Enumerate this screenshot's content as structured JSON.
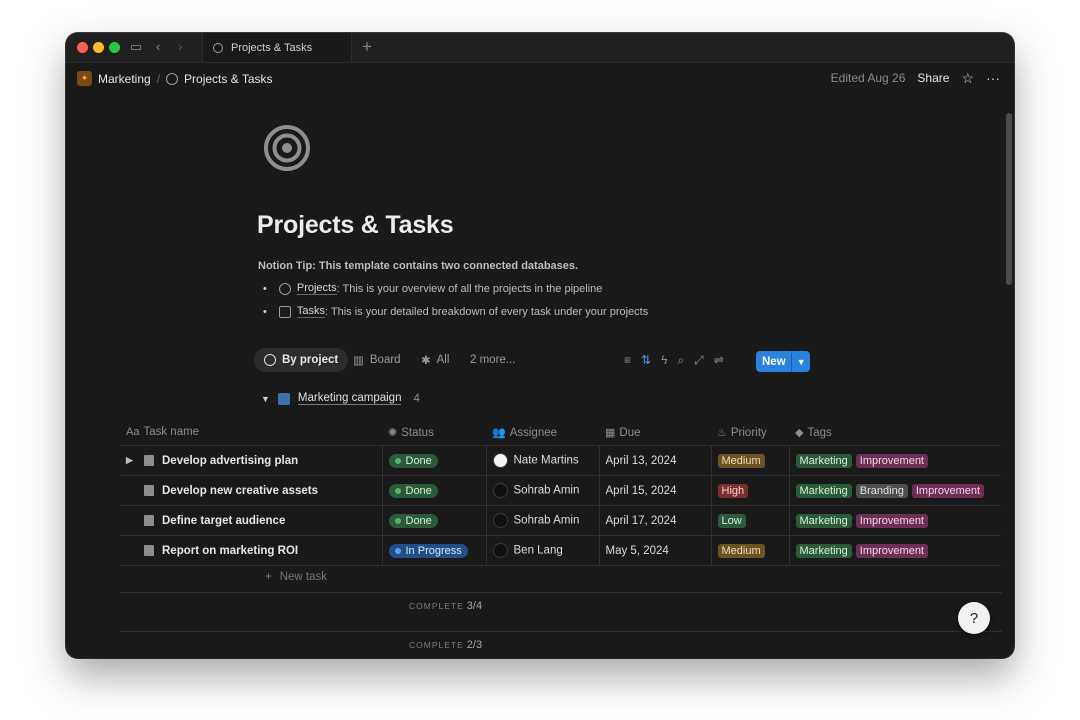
{
  "tab": {
    "title": "Projects & Tasks"
  },
  "breadcrumb": {
    "workspace": "Marketing",
    "separator": "/",
    "page": "Projects & Tasks"
  },
  "topbar": {
    "edited": "Edited Aug 26",
    "share": "Share",
    "favorite_icon": "star-icon",
    "more_icon": "more-icon"
  },
  "page": {
    "title": "Projects & Tasks",
    "tip": "Notion Tip: This template contains two connected databases.",
    "bullets": [
      {
        "link": "Projects",
        "text": ": This is your overview of all the projects in the pipeline"
      },
      {
        "link": "Tasks",
        "text": ": This is your detailed breakdown of every task under your projects"
      }
    ]
  },
  "views": {
    "by_project": "By project",
    "board": "Board",
    "all": "All",
    "more": "2 more...",
    "new": "New"
  },
  "group": {
    "name": "Marketing campaign",
    "count": "4"
  },
  "table": {
    "headers": {
      "task": "Task name",
      "status": "Status",
      "assignee": "Assignee",
      "due": "Due",
      "priority": "Priority",
      "tags": "Tags"
    },
    "rows": [
      {
        "task": "Develop advertising plan",
        "status": "Done",
        "assignee": "Nate Martins",
        "due": "April 13, 2024",
        "priority": "Medium",
        "tags": [
          "Marketing",
          "Improvement"
        ]
      },
      {
        "task": "Develop new creative assets",
        "status": "Done",
        "assignee": "Sohrab Amin",
        "due": "April 15, 2024",
        "priority": "High",
        "tags": [
          "Marketing",
          "Branding",
          "Improvement"
        ]
      },
      {
        "task": "Define target audience",
        "status": "Done",
        "assignee": "Sohrab Amin",
        "due": "April 17, 2024",
        "priority": "Low",
        "tags": [
          "Marketing",
          "Improvement"
        ]
      },
      {
        "task": "Report on marketing ROI",
        "status": "In Progress",
        "assignee": "Ben Lang",
        "due": "May 5, 2024",
        "priority": "Medium",
        "tags": [
          "Marketing",
          "Improvement"
        ]
      }
    ],
    "new_task": "New task"
  },
  "summary": [
    {
      "label": "COMPLETE",
      "value": "3/4"
    },
    {
      "label": "COMPLETE",
      "value": "2/3"
    }
  ],
  "colors": {
    "status": {
      "Done": {
        "bg": "#2b5a3b",
        "fg": "#d6f0dc",
        "dot": "#53b36c"
      },
      "In Progress": {
        "bg": "#1f4f86",
        "fg": "#d5e6fb",
        "dot": "#5aa0f0"
      }
    },
    "priority": {
      "Medium": {
        "bg": "#6b5326",
        "fg": "#f1dcb2"
      },
      "High": {
        "bg": "#7b2e2e",
        "fg": "#f6cfcf"
      },
      "Low": {
        "bg": "#2b5a3b",
        "fg": "#d2efd9"
      }
    },
    "tags": {
      "Marketing": {
        "bg": "#2b5a3b",
        "fg": "#d7f0dd"
      },
      "Improvement": {
        "bg": "#6d2f55",
        "fg": "#f4d3e6"
      },
      "Branding": {
        "bg": "#4f4f4f",
        "fg": "#e2e2e2"
      }
    }
  }
}
